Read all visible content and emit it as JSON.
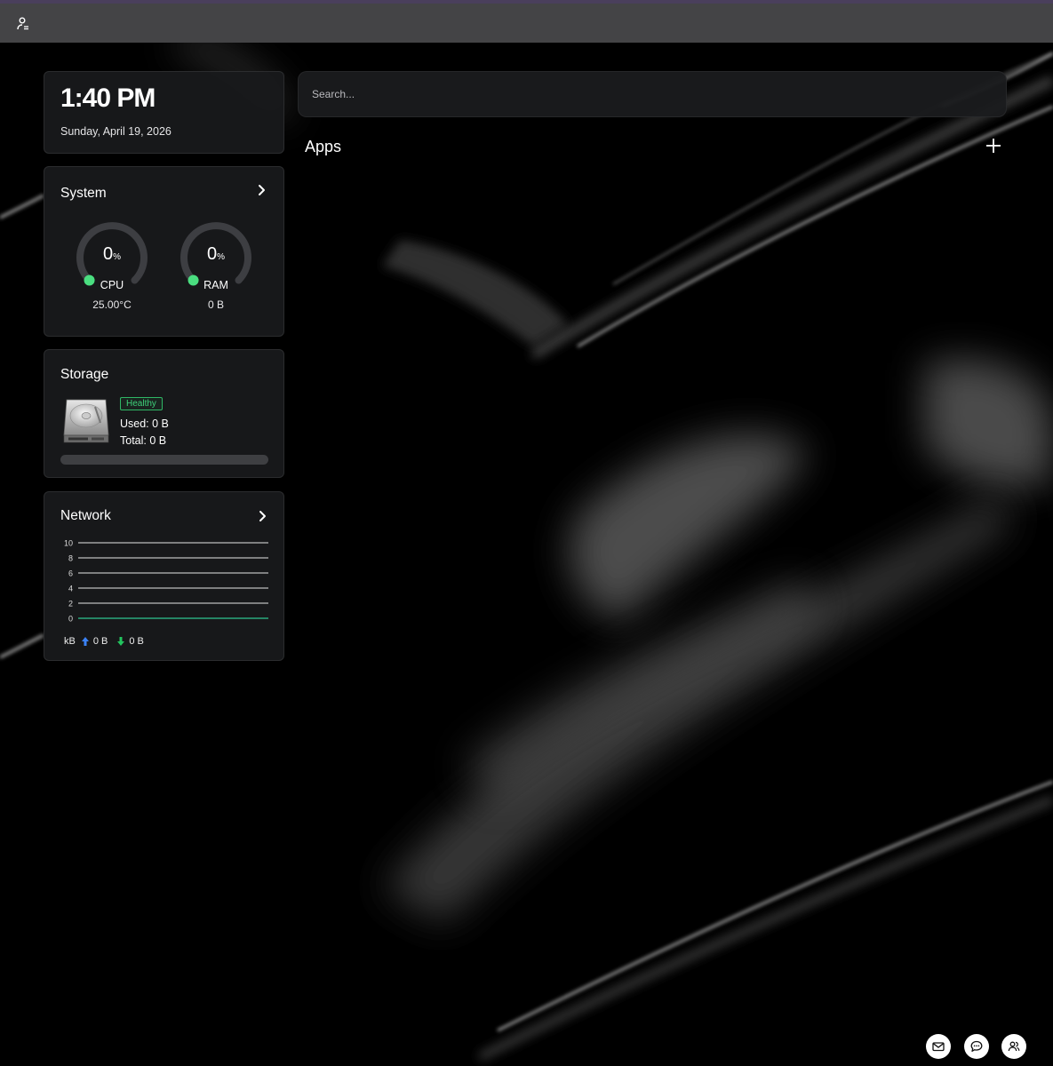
{
  "topbar": {
    "user_icon": "user-settings-icon"
  },
  "clock": {
    "time": "1:40 PM",
    "date": "Sunday, April 19, 2026"
  },
  "system": {
    "title": "System",
    "cpu": {
      "value": "0",
      "unit": "%",
      "label": "CPU",
      "sub": "25.00°C",
      "fraction": 0
    },
    "ram": {
      "value": "0",
      "unit": "%",
      "label": "RAM",
      "sub": "0 B",
      "fraction": 0
    },
    "accent_color": "#4ade80"
  },
  "storage": {
    "title": "Storage",
    "status": "Healthy",
    "used": "Used: 0 B",
    "total": "Total: 0 B",
    "fraction": 0,
    "status_color": "#3fd07a"
  },
  "network": {
    "title": "Network",
    "unit": "kB",
    "upload": "0 B",
    "download": "0 B",
    "upload_color": "#3b82f6",
    "download_color": "#22c55e",
    "chart_data": {
      "type": "line",
      "yticks": [
        "10",
        "8",
        "6",
        "4",
        "2",
        "0"
      ],
      "ylim": [
        0,
        10
      ],
      "series": [
        {
          "values": [
            0,
            0,
            0,
            0,
            0,
            0,
            0,
            0,
            0,
            0
          ]
        },
        {
          "values": [
            0,
            0,
            0,
            0,
            0,
            0,
            0,
            0,
            0,
            0
          ]
        }
      ]
    }
  },
  "search": {
    "placeholder": "Search..."
  },
  "apps": {
    "title": "Apps",
    "add_icon": "plus-icon"
  },
  "fabs": [
    "mail-icon",
    "message-icon",
    "users-icon"
  ]
}
